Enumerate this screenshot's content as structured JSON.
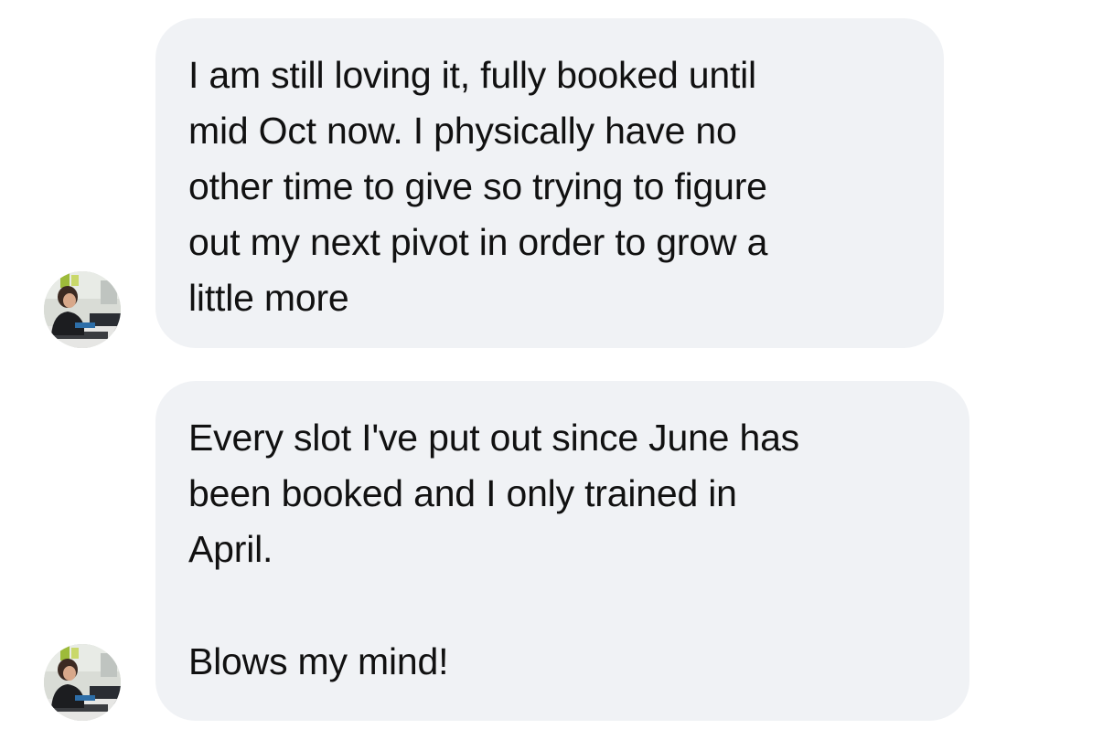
{
  "conversation": {
    "messages": [
      {
        "sender": "other",
        "avatar_icon": "user-photo-avatar",
        "paragraphs": [
          "I am still loving it, fully booked until\nmid Oct now. I physically have no\nother time to give so trying to figure\nout my next pivot in order to grow a\nlittle more"
        ]
      },
      {
        "sender": "other",
        "avatar_icon": "user-photo-avatar",
        "paragraphs": [
          "Every slot I've put out since June has\nbeen booked and I only trained in\nApril.",
          "Blows my mind!"
        ]
      }
    ]
  },
  "colors": {
    "bubble_background": "#f0f2f5",
    "text": "#111111",
    "page_background": "#ffffff"
  }
}
